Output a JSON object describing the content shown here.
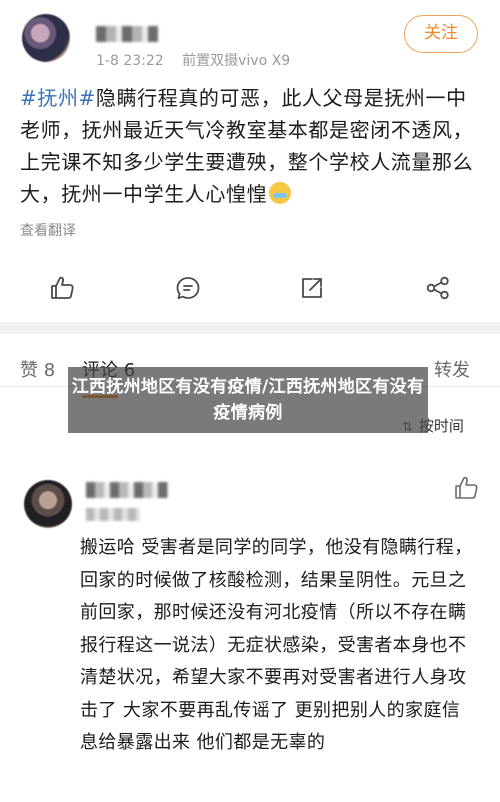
{
  "post": {
    "time": "1-8 23:22",
    "device": "前置双摄vivo X9",
    "follow_label": "关注",
    "topic": "#抚州#",
    "body": "隐瞒行程真的可恶，此人父母是抚州一中老师，抚州最近天气冷教室基本都是密闭不透风，上完课不知多少学生要遭殃，整个学校人流量那么大，抚州一中学生人心惶惶",
    "emoji": "crying-face-emoji",
    "translate_label": "查看翻译",
    "actions": [
      "thumbs-up-icon",
      "comment-icon",
      "repost-icon",
      "share-icon"
    ]
  },
  "tabs": {
    "likes": "赞 8",
    "comments": "评论 6",
    "reposts": "转发",
    "accent": "#ff8200"
  },
  "sort": {
    "label": "按时间"
  },
  "overlay": {
    "title": "江西抚州地区有没有疫情/江西抚州地区有没有疫情病例"
  },
  "comment": {
    "text": "搬运哈 受害者是同学的同学，他没有隐瞒行程，回家的时候做了核酸检测，结果呈阴性。元旦之前回家，那时候还没有河北疫情（所以不存在瞒报行程这一说法）无症状感染，受害者本身也不清楚状况，希望大家不要再对受害者进行人身攻击了 大家不要再乱传谣了 更别把别人的家庭信息给暴露出来 他们都是无辜的"
  }
}
